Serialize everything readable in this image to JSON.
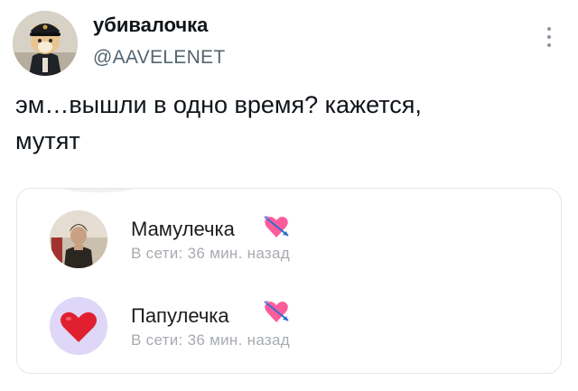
{
  "author": {
    "name": "убивалочка",
    "handle": "@AAVELENET",
    "avatar_icon": "cat-in-police-cap-avatar"
  },
  "tweet": {
    "text_line1": "эм…вышли в одно время? кажется,",
    "text_line2": "мутят"
  },
  "embed": {
    "contacts": [
      {
        "name": "Мамулечка",
        "status": "В сети: 36 мин. назад",
        "avatar_icon": "woman-photo-avatar",
        "emoji_icon": "heart-with-arrow-icon"
      },
      {
        "name": "Папулечка",
        "status": "В сети: 36 мин. назад",
        "avatar_icon": "red-heart-avatar",
        "emoji_icon": "heart-with-arrow-icon"
      }
    ]
  },
  "colors": {
    "text": "#0f1419",
    "handle": "#536471",
    "status": "#a7abb0",
    "heart": "#e0202f",
    "heart_bg": "#d9d3f5",
    "emoji_pink": "#ff5c9c"
  }
}
